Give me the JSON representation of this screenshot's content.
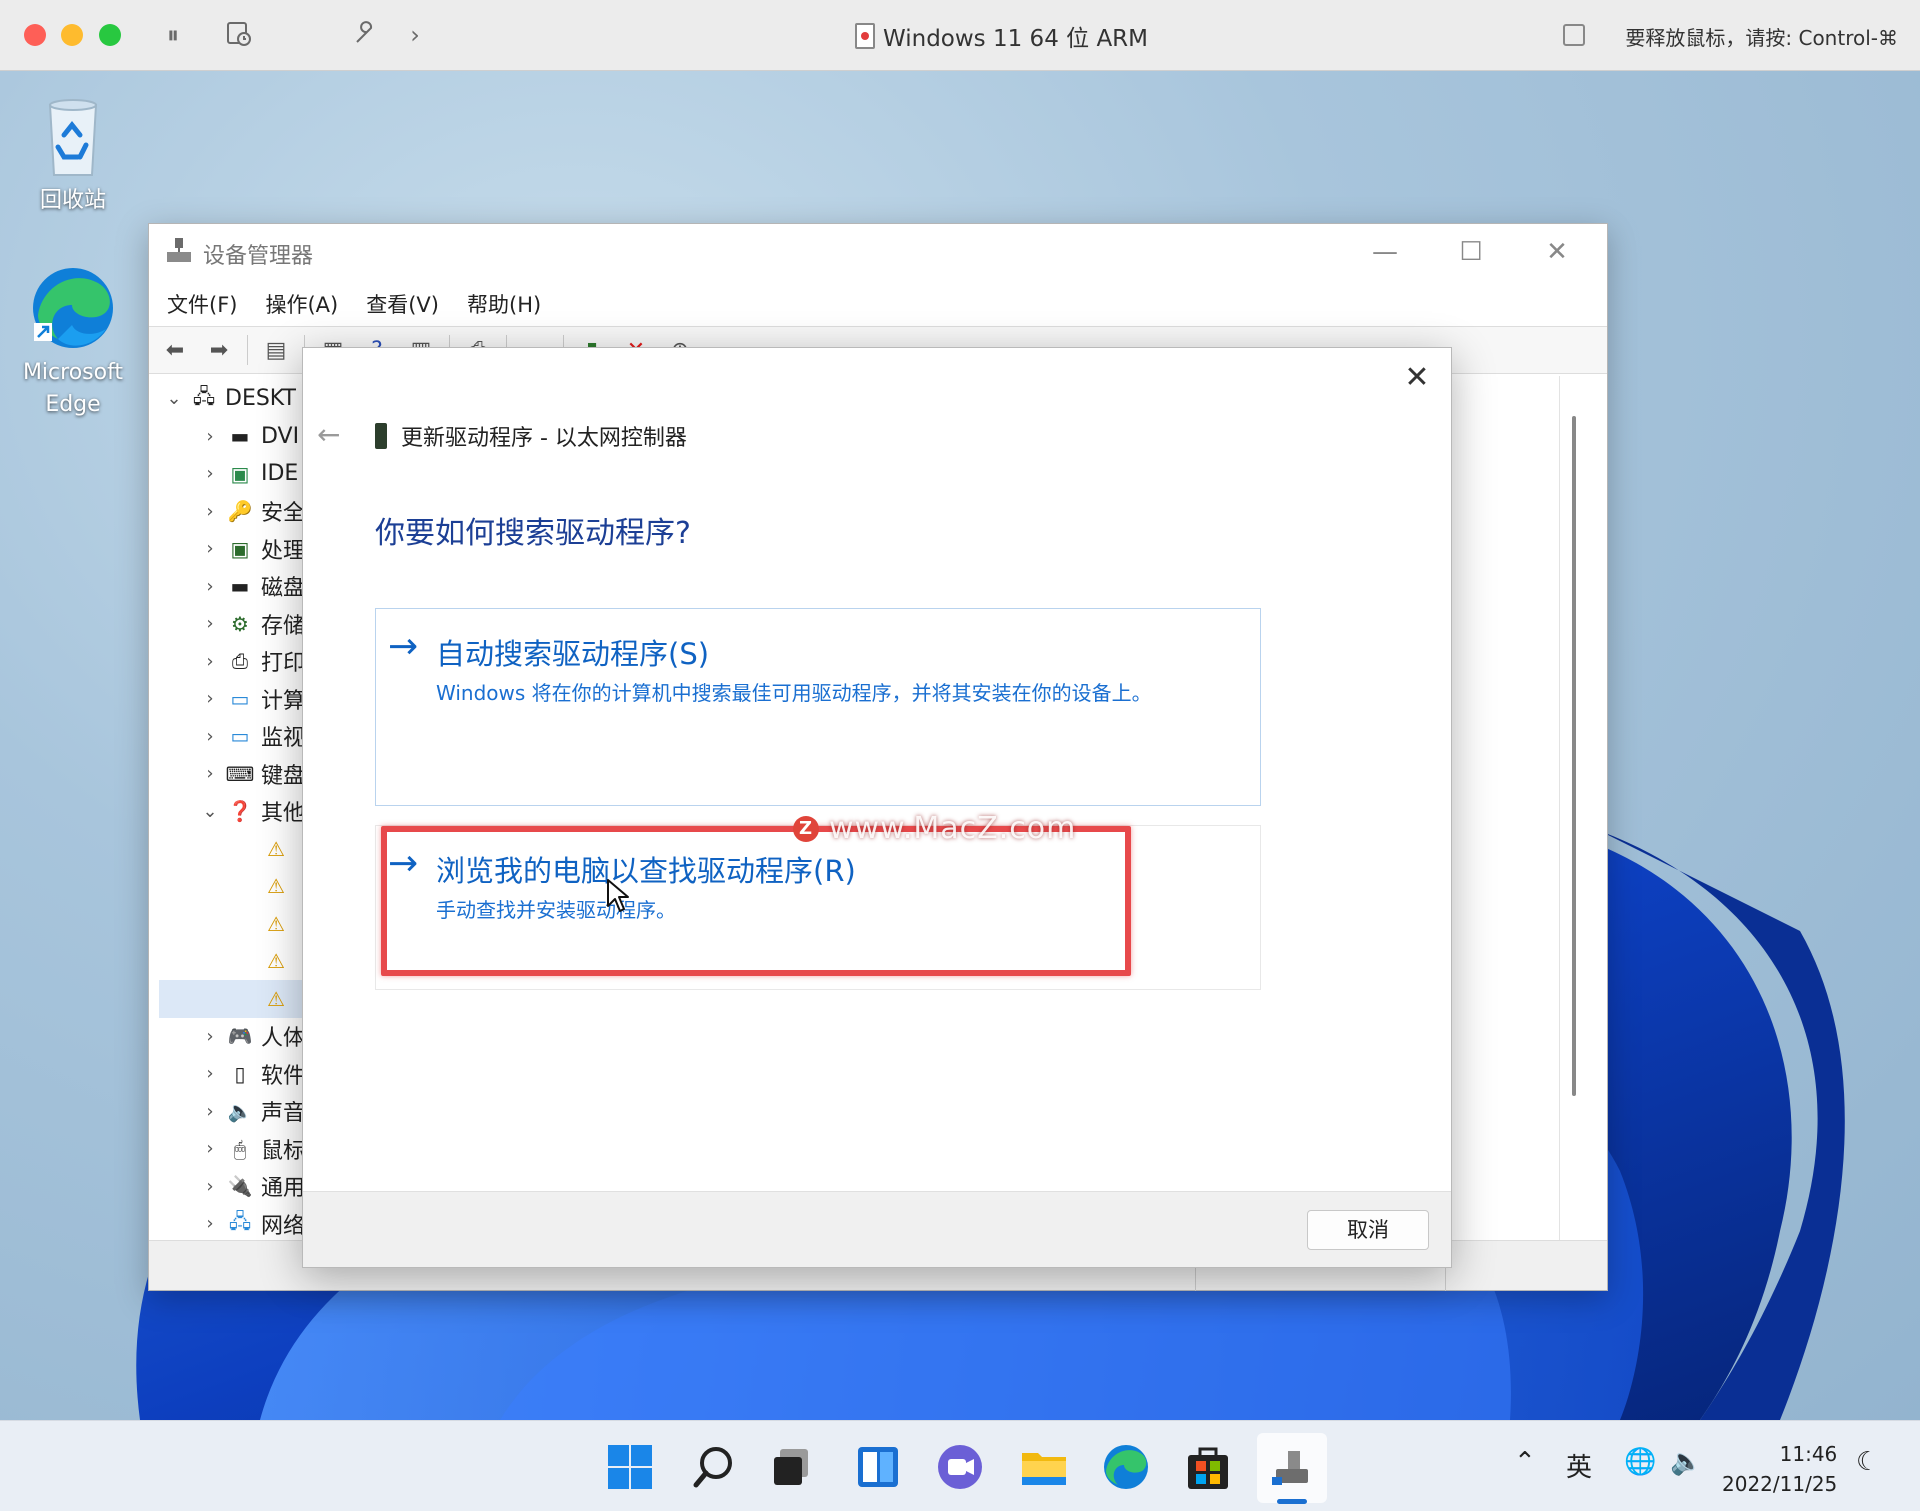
{
  "host": {
    "title": "Windows 11 64 位 ARM",
    "hint": "要释放鼠标，请按: Control-⌘"
  },
  "desktop": {
    "icons": [
      {
        "label": "回收站"
      },
      {
        "label_line1": "Microsoft",
        "label_line2": "Edge"
      }
    ]
  },
  "devmgr": {
    "title": "设备管理器",
    "menu": [
      "文件(F)",
      "操作(A)",
      "查看(V)",
      "帮助(H)"
    ],
    "tree": [
      {
        "label": "DESKT",
        "chev": "⌄"
      },
      {
        "label": "DVI",
        "chev": "›"
      },
      {
        "label": "IDE",
        "chev": "›"
      },
      {
        "label": "安全",
        "chev": "›"
      },
      {
        "label": "处理",
        "chev": "›"
      },
      {
        "label": "磁盘",
        "chev": "›"
      },
      {
        "label": "存储",
        "chev": "›"
      },
      {
        "label": "打印",
        "chev": "›"
      },
      {
        "label": "计算",
        "chev": "›"
      },
      {
        "label": "监视",
        "chev": "›"
      },
      {
        "label": "键盘",
        "chev": "›"
      },
      {
        "label": "其他",
        "chev": "⌄"
      },
      {
        "label": "",
        "chev": ""
      },
      {
        "label": "",
        "chev": ""
      },
      {
        "label": "",
        "chev": ""
      },
      {
        "label": "",
        "chev": ""
      },
      {
        "label": "",
        "chev": ""
      },
      {
        "label": "人体",
        "chev": "›"
      },
      {
        "label": "软件",
        "chev": "›"
      },
      {
        "label": "声音",
        "chev": "›"
      },
      {
        "label": "鼠标",
        "chev": "›"
      },
      {
        "label": "通用",
        "chev": "›"
      },
      {
        "label": "网络",
        "chev": "›"
      }
    ]
  },
  "wizard": {
    "header": "更新驱动程序 - 以太网控制器",
    "question": "你要如何搜索驱动程序?",
    "option_auto": {
      "title": "自动搜索驱动程序(S)",
      "desc": "Windows 将在你的计算机中搜索最佳可用驱动程序，并将其安装在你的设备上。"
    },
    "option_browse": {
      "title": "浏览我的电脑以查找驱动程序(R)",
      "desc": "手动查找并安装驱动程序。"
    },
    "cancel": "取消",
    "watermark": "www.MacZ.com",
    "watermark_badge": "Z"
  },
  "taskbar": {
    "ime": "英",
    "time": "11:46",
    "date": "2022/11/25"
  }
}
